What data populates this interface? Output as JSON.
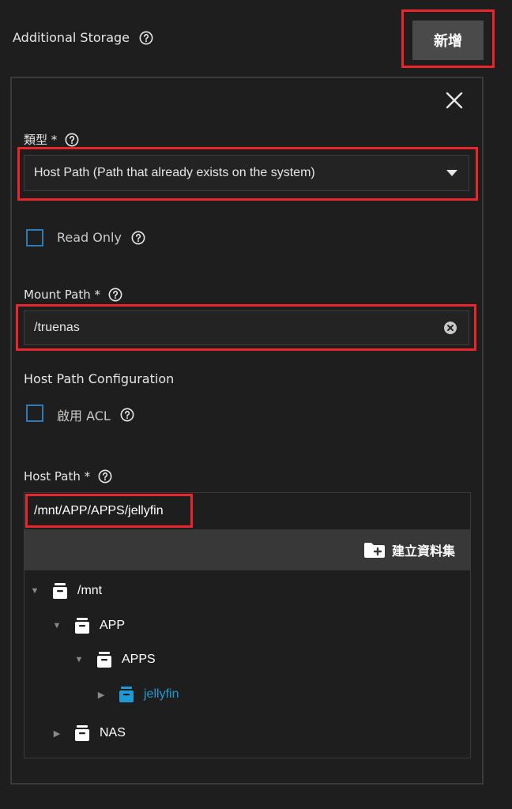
{
  "header": {
    "title": "Additional Storage",
    "add_button": "新增"
  },
  "form": {
    "type": {
      "label": "類型",
      "required_mark": "*",
      "value": "Host Path (Path that already exists on the system)"
    },
    "read_only": {
      "label": "Read Only",
      "checked": false
    },
    "mount_path": {
      "label": "Mount Path",
      "required_mark": "*",
      "value": "/truenas"
    },
    "host_path_config": {
      "title": "Host Path Configuration",
      "acl_label": "啟用 ACL",
      "acl_checked": false
    },
    "host_path": {
      "label": "Host Path",
      "required_mark": "*",
      "value": "/mnt/APP/APPS/jellyfin"
    }
  },
  "explorer": {
    "create_dataset_label": "建立資料集",
    "nodes": [
      {
        "name": "/mnt",
        "level": 0,
        "expanded": true,
        "selected": false
      },
      {
        "name": "APP",
        "level": 1,
        "expanded": true,
        "selected": false
      },
      {
        "name": "APPS",
        "level": 2,
        "expanded": true,
        "selected": false
      },
      {
        "name": "jellyfin",
        "level": 3,
        "expanded": false,
        "selected": true
      },
      {
        "name": "NAS",
        "level": 1,
        "expanded": false,
        "selected": false
      }
    ]
  },
  "colors": {
    "background": "#1e1e1e",
    "highlight_red": "#e8262b",
    "accent_blue": "#1e9bd7",
    "checkbox_border": "#2b7bb9",
    "button_bg": "#4a4a4a"
  }
}
